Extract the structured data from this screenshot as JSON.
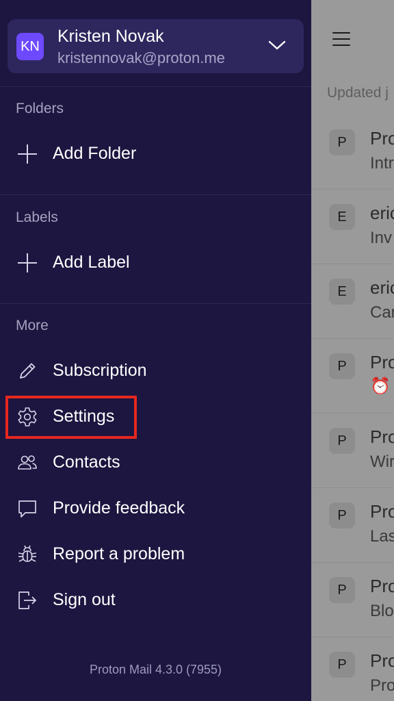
{
  "account": {
    "initials": "KN",
    "name": "Kristen Novak",
    "email": "kristennovak@proton.me"
  },
  "sections": {
    "folders": "Folders",
    "labels": "Labels",
    "more": "More"
  },
  "menu": {
    "add_folder": "Add Folder",
    "add_label": "Add Label",
    "subscription": "Subscription",
    "settings": "Settings",
    "contacts": "Contacts",
    "provide_feedback": "Provide feedback",
    "report_problem": "Report a problem",
    "sign_out": "Sign out"
  },
  "version": "Proton Mail 4.3.0 (7955)",
  "background": {
    "updated_text": "Updated j",
    "mails": [
      {
        "avatar": "P",
        "sender": "Pro",
        "subject": "Intr"
      },
      {
        "avatar": "E",
        "sender": "eric",
        "subject": "Inv"
      },
      {
        "avatar": "E",
        "sender": "eric",
        "subject": "Car"
      },
      {
        "avatar": "P",
        "sender": "Pro",
        "subject": "⏰"
      },
      {
        "avatar": "P",
        "sender": "Pro",
        "subject": "Wir"
      },
      {
        "avatar": "P",
        "sender": "Pro",
        "subject": "Las"
      },
      {
        "avatar": "P",
        "sender": "Pro",
        "subject": "Blo"
      },
      {
        "avatar": "P",
        "sender": "Pro",
        "subject": "Pro"
      }
    ]
  },
  "colors": {
    "drawer_bg": "#1c1640",
    "account_card_bg": "#2e275e",
    "avatar_accent": "#6d4aff",
    "highlight": "#e8271e"
  }
}
